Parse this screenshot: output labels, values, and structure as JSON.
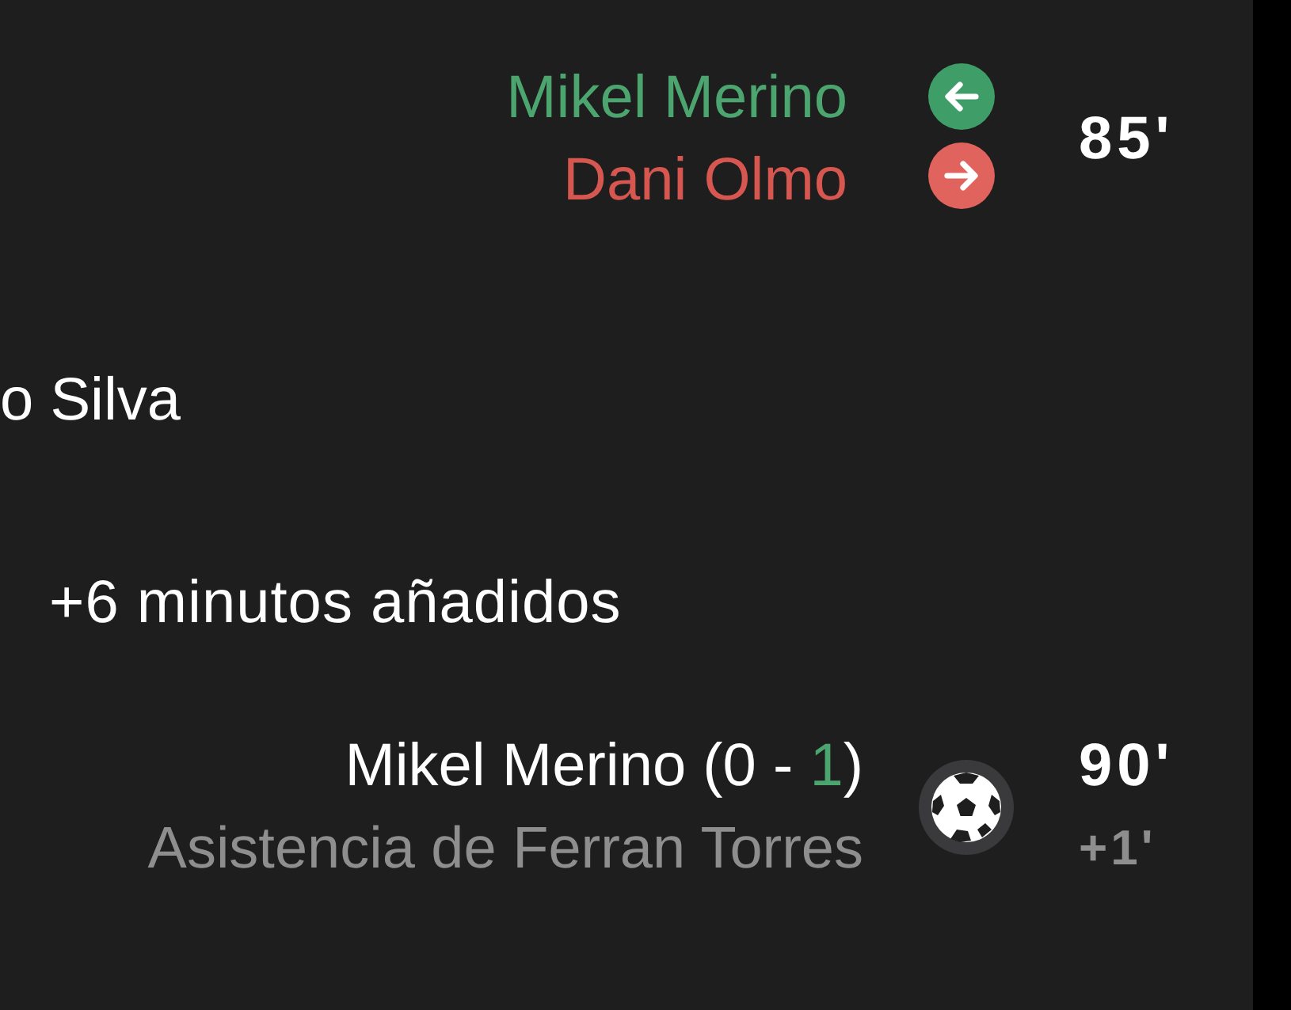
{
  "events": [
    {
      "kind": "substitution",
      "players": [
        {
          "name": "Mikel Merino",
          "kind": "in"
        },
        {
          "name": "Dani Olmo",
          "kind": "out"
        }
      ],
      "minute": "85'"
    },
    {
      "kind": "cut_event",
      "text": "o Silva"
    },
    {
      "kind": "added_time",
      "text": "+6 minutos añadidos"
    },
    {
      "kind": "goal",
      "scorer_parts": [
        {
          "text": "Mikel Merino (0 - ",
          "highlighted": false
        },
        {
          "text": "1",
          "highlighted": true
        },
        {
          "text": ")",
          "highlighted": false
        }
      ],
      "assist": "Asistencia de Ferran Torres",
      "minute": "90'",
      "added": "+1'"
    }
  ]
}
